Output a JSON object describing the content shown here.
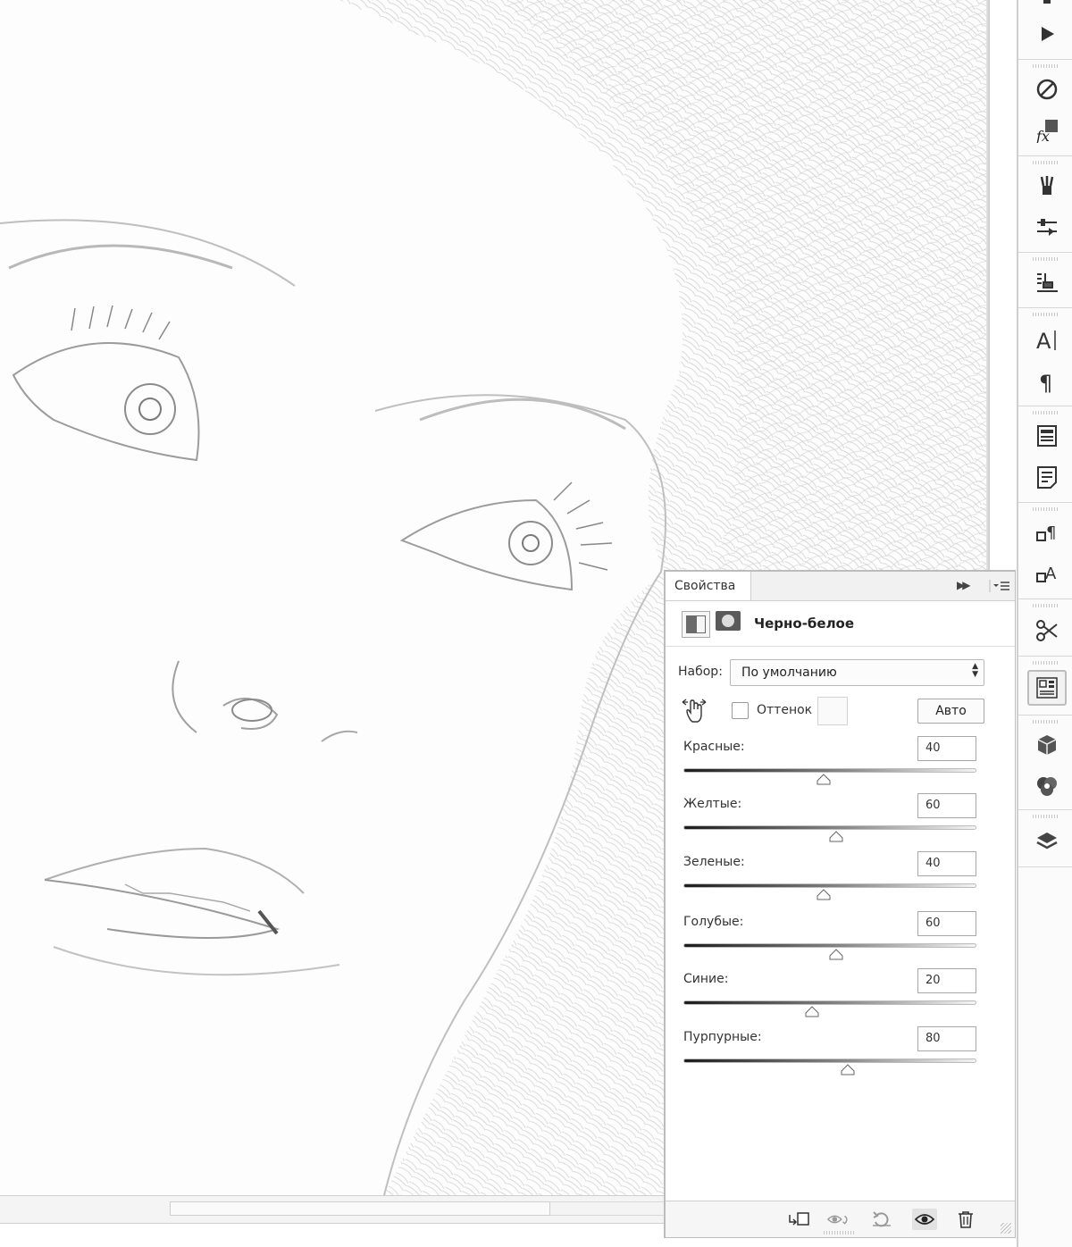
{
  "canvas": {
    "photo_description_icon": "pencil-sketch-portrait"
  },
  "panel": {
    "tab_label": "Свойства",
    "title": "Черно-белое",
    "preset_label": "Набор:",
    "preset_value": "По умолчанию",
    "tint_label": "Оттенок",
    "tint_checked": false,
    "auto_label": "Авто",
    "channels": [
      {
        "label": "Красные:",
        "value": "40",
        "level": 40
      },
      {
        "label": "Желтые:",
        "value": "60",
        "level": 60
      },
      {
        "label": "Зеленые:",
        "value": "40",
        "level": 40
      },
      {
        "label": "Голубые:",
        "value": "60",
        "level": 60
      },
      {
        "label": "Синие:",
        "value": "20",
        "level": 20
      },
      {
        "label": "Пурпурные:",
        "value": "80",
        "level": 80
      }
    ],
    "slider_range": [
      -200,
      300
    ],
    "footer_icons": [
      "clip-to-layer-icon",
      "view-previous-state-icon",
      "reset-icon",
      "visibility-eye-icon",
      "delete-icon"
    ]
  },
  "dock": {
    "icons": [
      "play-icon",
      "no-entry-icon",
      "fx-styles-icon",
      "brushes-icon",
      "adjust-sliders-icon",
      "clone-source-icon",
      "character-icon",
      "paragraph-icon",
      "paragraph-styles-icon",
      "character-styles-panel-icon",
      "paragraph-style-icon",
      "character-style-icon",
      "tools-scissors-icon",
      "properties-panel-icon",
      "3d-cube-icon",
      "channels-icon",
      "layers-icon"
    ]
  },
  "colors": {
    "background": "#ffffff",
    "panel_border": "#bcbcbc",
    "accent": "#222222"
  }
}
